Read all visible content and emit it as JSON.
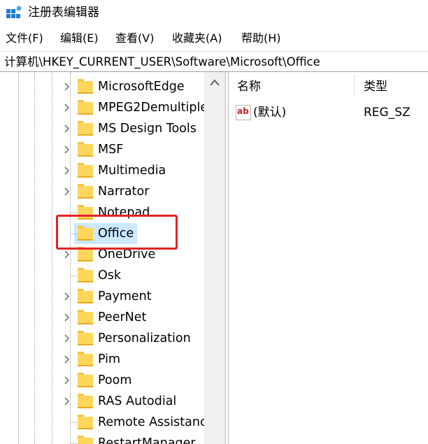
{
  "window": {
    "title": "注册表编辑器",
    "icon": "regedit-icon"
  },
  "menu": {
    "items": [
      "文件(F)",
      "编辑(E)",
      "查看(V)",
      "收藏夹(A)",
      "帮助(H)"
    ]
  },
  "address": {
    "path": "计算机\\HKEY_CURRENT_USER\\Software\\Microsoft\\Office"
  },
  "tree": {
    "selected": "Office",
    "items": [
      {
        "label": "MicrosoftEdge",
        "expandable": true
      },
      {
        "label": "MPEG2Demultiple",
        "expandable": true
      },
      {
        "label": "MS Design Tools",
        "expandable": true
      },
      {
        "label": "MSF",
        "expandable": true
      },
      {
        "label": "Multimedia",
        "expandable": true
      },
      {
        "label": "Narrator",
        "expandable": true
      },
      {
        "label": "Notepad",
        "expandable": false
      },
      {
        "label": "Office",
        "expandable": false
      },
      {
        "label": "OneDrive",
        "expandable": true
      },
      {
        "label": "Osk",
        "expandable": false
      },
      {
        "label": "Payment",
        "expandable": true
      },
      {
        "label": "PeerNet",
        "expandable": true
      },
      {
        "label": "Personalization",
        "expandable": true
      },
      {
        "label": "Pim",
        "expandable": true
      },
      {
        "label": "Poom",
        "expandable": true
      },
      {
        "label": "RAS Autodial",
        "expandable": true
      },
      {
        "label": "Remote Assistanc",
        "expandable": false
      },
      {
        "label": "RestartManager",
        "expandable": false
      }
    ]
  },
  "values": {
    "headers": {
      "name": "名称",
      "type": "类型"
    },
    "rows": [
      {
        "name": "(默认)",
        "type": "REG_SZ",
        "icon": "ab",
        "icon_name": "string-value-icon"
      }
    ]
  },
  "colors": {
    "highlight": "#e02424",
    "selection": "#cce8ff",
    "folder": "#ffd65c"
  }
}
